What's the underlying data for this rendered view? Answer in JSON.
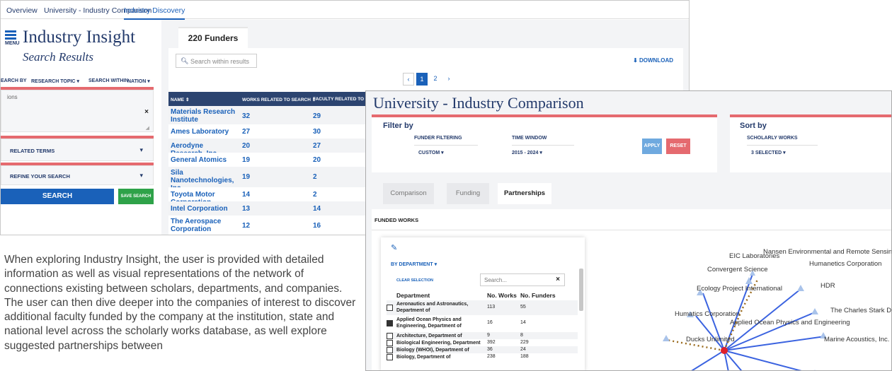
{
  "topnav": {
    "items": [
      "Overview",
      "University - Industry Comparison",
      "Industry Discovery"
    ]
  },
  "back": {
    "menu_label": "MENU",
    "brand": "Industry Insight",
    "subtitle": "Search Results",
    "search_by_label": "EARCH BY",
    "search_by_value": "RESEARCH TOPIC",
    "search_within_label": "SEARCH WITHIN",
    "search_within_value": "NATION",
    "query_text": "ions",
    "related_terms": "RELATED TERMS",
    "refine": "REFINE YOUR SEARCH",
    "search_btn": "SEARCH",
    "save_search_btn": "SAVE SEARCH",
    "funders_tab": "220 Funders",
    "search_placeholder": "Search within results",
    "download": "DOWNLOAD",
    "pages": [
      "1",
      "2"
    ],
    "columns": [
      "NAME ⇕",
      "WORKS RELATED TO SEARCH ⇕",
      "FACULTY RELATED TO SEARCH"
    ],
    "rows": [
      {
        "name": "Materials Research Institute",
        "works": "32",
        "faculty": "29"
      },
      {
        "name": "Ames Laboratory",
        "works": "27",
        "faculty": "30"
      },
      {
        "name": "Aerodyne Research, Inc",
        "works": "20",
        "faculty": "27"
      },
      {
        "name": "General Atomics",
        "works": "19",
        "faculty": "20"
      },
      {
        "name": "Sila Nanotechnologies, Inc.",
        "works": "19",
        "faculty": "2"
      },
      {
        "name": "Toyota Motor Corporation",
        "works": "14",
        "faculty": "2"
      },
      {
        "name": "Intel Corporation",
        "works": "13",
        "faculty": "14"
      },
      {
        "name": "The Aerospace Corporation",
        "works": "12",
        "faculty": "16"
      }
    ]
  },
  "front": {
    "title": "University - Industry Comparison",
    "filter_by": "Filter by",
    "funder_filtering_label": "FUNDER FILTERING",
    "funder_filtering_value": "CUSTOM",
    "time_window_label": "TIME WINDOW",
    "time_window_value": "2015 - 2024",
    "apply": "APPLY",
    "reset": "RESET",
    "sort_by": "Sort by",
    "scholarly_works_label": "SCHOLARLY WORKS",
    "scholarly_works_value": "3 SELECTED",
    "tabs": [
      "Comparison",
      "Funding",
      "Partnerships"
    ],
    "section_label": "FUNDED WORKS",
    "by_department": "BY DEPARTMENT",
    "clear_selection": "CLEAR SELECTION",
    "dept_search_placeholder": "Search...",
    "dept_columns": [
      "Department",
      "No. Works",
      "No. Funders"
    ],
    "departments": [
      {
        "name": "Aeronautics and Astronautics, Department of",
        "works": "113",
        "funders": "55",
        "checked": false
      },
      {
        "name": "Applied Ocean Physics and Engineering, Department of",
        "works": "16",
        "funders": "14",
        "checked": true
      },
      {
        "name": "Architecture, Department of",
        "works": "9",
        "funders": "8",
        "checked": false
      },
      {
        "name": "Biological Engineering, Department of",
        "works": "392",
        "funders": "229",
        "checked": false
      },
      {
        "name": "Biology (WHOI), Department of",
        "works": "36",
        "funders": "24",
        "checked": false
      },
      {
        "name": "Biology, Department of",
        "works": "238",
        "funders": "188",
        "checked": false
      }
    ],
    "network_labels": [
      "Nansen Environmental and Remote Sensing Cer",
      "EIC Laboratories",
      "Humanetics Corporation",
      "Convergent Science",
      "HDR",
      "Ecology Project International",
      "The Charles Stark Draper La",
      "Humatics Corporation",
      "Applied Ocean Physics and Engineering",
      "Ducks Unlimited",
      "Marine Acoustics, Inc."
    ]
  },
  "paragraph": "When exploring Industry Insight, the user is provided with detailed information as well as visual representations of the network of connections existing between scholars, departments, and companies. The user can then dive deeper into the companies of interest to discover additional faculty funded by the company at the institution, state and national level across the scholarly works database, as well explore suggested partnerships between",
  "colors": {
    "navy": "#233a6b",
    "blue": "#1a61b9",
    "accent_red": "#e56a6f",
    "green": "#2ea249",
    "link_blue": "#3b63e0",
    "dotted_brown": "#9a6b1e"
  }
}
